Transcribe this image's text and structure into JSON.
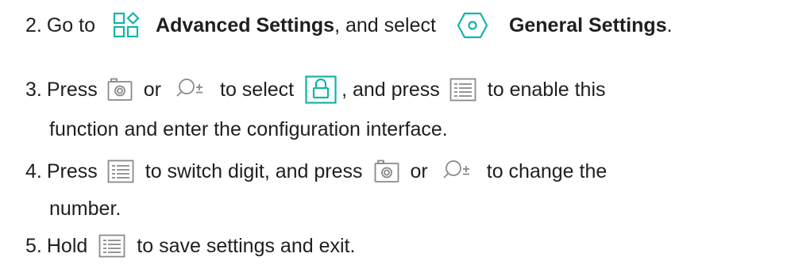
{
  "steps": [
    {
      "num": "2.",
      "parts": [
        "Go to",
        "Advanced Settings",
        ", and select",
        "General Settings",
        "."
      ]
    },
    {
      "num": "3.",
      "parts": [
        "Press",
        "or",
        "to select",
        ", and press",
        "to enable this"
      ],
      "continuation": "function and enter the configuration interface."
    },
    {
      "num": "4.",
      "parts": [
        "Press",
        "to switch digit, and press",
        "or",
        "to change the"
      ],
      "continuation": "number."
    },
    {
      "num": "5.",
      "parts": [
        "Hold",
        "to save settings and exit."
      ]
    }
  ],
  "icons": {
    "advanced_settings": "grid-settings-icon",
    "general_settings": "hexagon-circle-icon",
    "camera": "camera-icon",
    "zoom": "zoom-plus-minus-icon",
    "lock": "lock-icon",
    "menu": "menu-list-icon"
  },
  "colors": {
    "accent": "#12b5a8",
    "icon_gray": "#8a8a8a",
    "text": "#1f1f1f"
  }
}
